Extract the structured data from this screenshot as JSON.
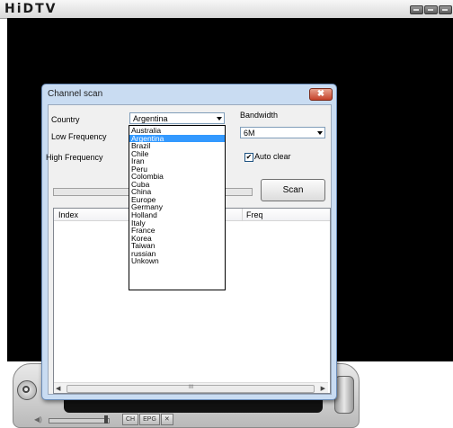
{
  "app": {
    "logo": "HiDTV",
    "controls": {
      "epg_label": "EPG",
      "ch_label": "CH",
      "tools_glyph": "✕"
    }
  },
  "dialog": {
    "title": "Channel scan",
    "close_glyph": "✖",
    "labels": {
      "country": "Country",
      "low_frequency": "Low Frequency",
      "high_frequency": "High Frequency",
      "bandwidth": "Bandwidth"
    },
    "country_value": "Argentina",
    "bandwidth_value": "6M",
    "auto_clear": {
      "label": "Auto clear",
      "checked": true,
      "glyph": "✔"
    },
    "scan_button": "Scan",
    "list_columns": {
      "index": "Index",
      "freq": "Freq"
    },
    "hscroll": {
      "left": "◀",
      "right": "▶",
      "grip": "III"
    }
  },
  "country_dropdown": {
    "selected": "Argentina",
    "options": [
      "Australia",
      "Argentina",
      "Brazil",
      "Chile",
      "Iran",
      "Peru",
      "Colombia",
      "Cuba",
      "China",
      "Europe",
      "Germany",
      "Holland",
      "Italy",
      "France",
      "Korea",
      "Taiwan",
      "russian",
      "Unkown"
    ]
  }
}
